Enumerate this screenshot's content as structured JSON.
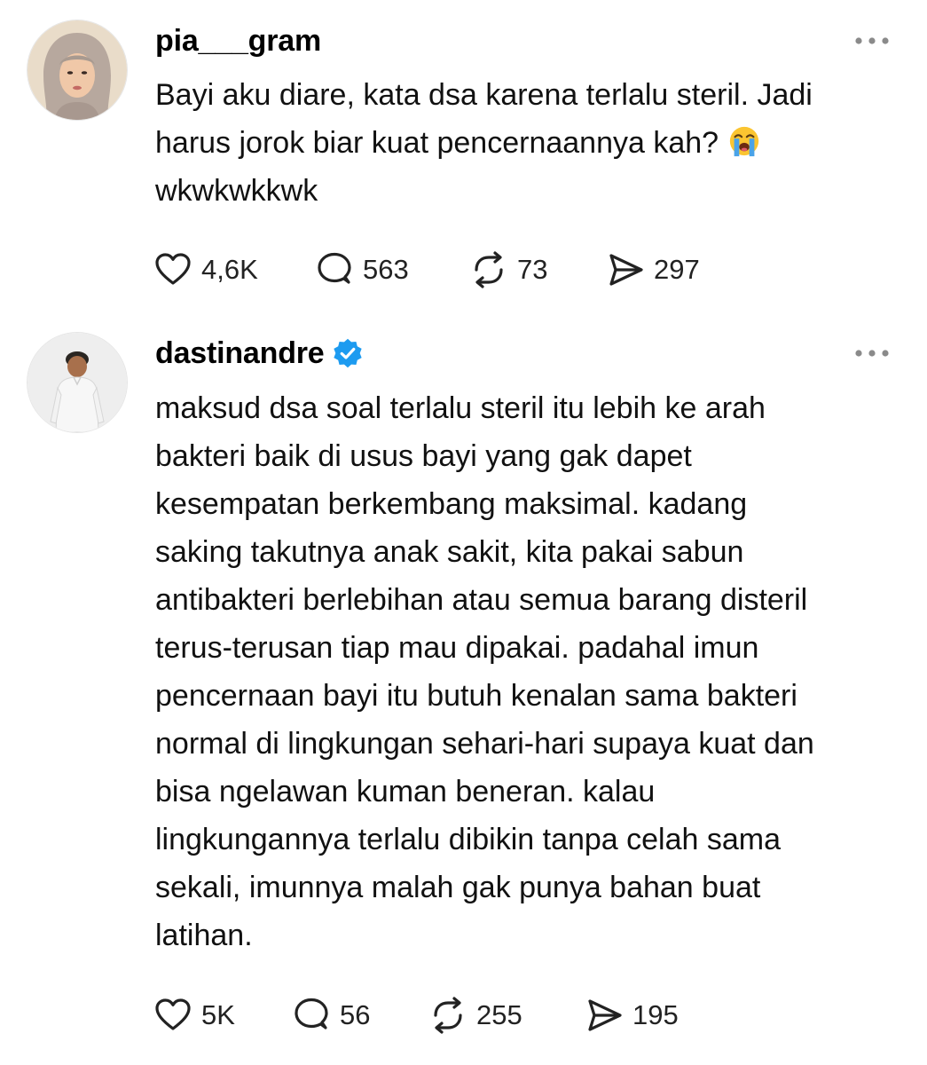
{
  "posts": [
    {
      "username": "pia___gram",
      "verified": false,
      "text_before_emoji": "Bayi aku diare, kata dsa karena terlalu steril. Jadi\nharus jorok biar kuat pencernaannya kah? ",
      "emoji": "loudly-crying-face",
      "text_after_emoji": "\nwkwkwkkwk",
      "actions": {
        "likes": "4,6K",
        "replies": "563",
        "reposts": "73",
        "shares": "297"
      }
    },
    {
      "username": "dastinandre",
      "verified": true,
      "text": "maksud dsa soal terlalu steril itu lebih ke arah\nbakteri baik di usus bayi yang gak dapet\nkesempatan berkembang maksimal. kadang\nsaking takutnya anak sakit, kita pakai sabun\nantibakteri berlebihan atau semua barang disteril\nterus-terusan tiap mau dipakai. padahal imun\npencernaan bayi itu butuh kenalan sama bakteri\nnormal di lingkungan sehari-hari supaya kuat dan\nbisa ngelawan kuman beneran. kalau\nlingkungannya terlalu dibikin tanpa celah sama\nsekali, imunnya malah gak punya bahan buat\nlatihan.",
      "actions": {
        "likes": "5K",
        "replies": "56",
        "reposts": "255",
        "shares": "195"
      }
    }
  ],
  "icons": {
    "like": "heart-icon",
    "reply": "speech-bubble-icon",
    "repost": "repost-arrows-icon",
    "share": "send-icon",
    "more": "more-dots-icon",
    "verified": "verified-badge-icon"
  },
  "colors": {
    "text": "#111111",
    "icon": "#222222",
    "verified": "#1d9bf0"
  }
}
